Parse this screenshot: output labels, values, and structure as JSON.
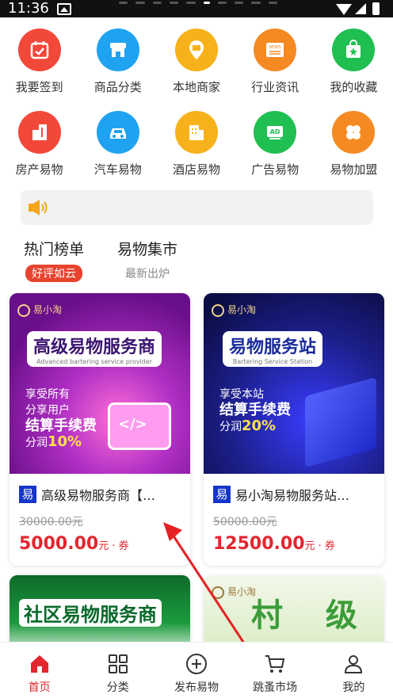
{
  "status_bar": {
    "time": "11:36"
  },
  "grid": {
    "row1": [
      {
        "label": "我要签到",
        "icon": "calendar-check-icon",
        "color": "#f2483a"
      },
      {
        "label": "商品分类",
        "icon": "store-icon",
        "color": "#1fa3f0"
      },
      {
        "label": "本地商家",
        "icon": "location-shop-icon",
        "color": "#f7b21b"
      },
      {
        "label": "行业资讯",
        "icon": "news-icon",
        "color": "#f58a23"
      },
      {
        "label": "我的收藏",
        "icon": "bag-star-icon",
        "color": "#1fbf52"
      }
    ],
    "row2": [
      {
        "label": "房产易物",
        "icon": "building-icon",
        "color": "#f2483a"
      },
      {
        "label": "汽车易物",
        "icon": "car-icon",
        "color": "#1fa3f0"
      },
      {
        "label": "酒店易物",
        "icon": "hotel-icon",
        "color": "#f7b21b"
      },
      {
        "label": "广告易物",
        "icon": "ad-icon",
        "color": "#1fbf52"
      },
      {
        "label": "易物加盟",
        "icon": "clover-icon",
        "color": "#f58a23"
      }
    ]
  },
  "tabs": [
    {
      "title": "热门榜单",
      "subtitle": "好评如云",
      "active": true
    },
    {
      "title": "易物集市",
      "subtitle": "最新出炉",
      "active": false
    }
  ],
  "products": [
    {
      "banner_logo": "易小淘",
      "banner_headline": "高级易物服务商",
      "banner_headline_sub": "Advanced bartering service provider",
      "banner_lines": [
        "享受所有",
        "分享用户",
        "结算手续费",
        "分润",
        "10%"
      ],
      "badge": "易",
      "name": "高级易物服务商【…",
      "old_price": "30000.00元",
      "price": "5000.00",
      "price_unit": "元 · 券"
    },
    {
      "banner_logo": "易小淘",
      "banner_headline": "易物服务站",
      "banner_headline_sub": "Bartering Service Station",
      "banner_lines": [
        "享受本站",
        "结算手续费",
        "分润",
        "20%"
      ],
      "badge": "易",
      "name": "易小淘易物服务站…",
      "old_price": "50000.00元",
      "price": "12500.00",
      "price_unit": "元 · 券"
    },
    {
      "banner_headline": "社区易物服务商"
    },
    {
      "banner_logo": "易小淘",
      "banner_headline": "村 级"
    }
  ],
  "bottom_nav": [
    {
      "label": "首页",
      "icon": "home-icon",
      "active": true
    },
    {
      "label": "分类",
      "icon": "category-grid-icon",
      "active": false
    },
    {
      "label": "发布易物",
      "icon": "plus-circle-icon",
      "active": false
    },
    {
      "label": "跳蚤市场",
      "icon": "cart-icon",
      "active": false
    },
    {
      "label": "我的",
      "icon": "user-icon",
      "active": false
    }
  ],
  "colors": {
    "accent": "#e3262f",
    "tab_pill": "#e8432f"
  }
}
